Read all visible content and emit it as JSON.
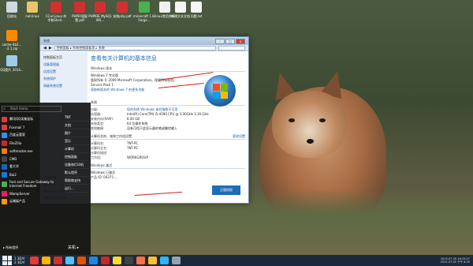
{
  "desktop_icons": [
    {
      "label": "回收站"
    },
    {
      "label": "nat-linux"
    },
    {
      "label": "CCal Linux 命令和Shell..."
    },
    {
      "label": "PHP环境配置.pdf"
    },
    {
      "label": "PHPIDE MySQL WS..."
    },
    {
      "label": "安装php.pdf"
    },
    {
      "label": "minecraft 1.8-Forge..."
    },
    {
      "label": "linux常用命令"
    },
    {
      "label": "新建文本文档"
    },
    {
      "label": "问题.txt"
    },
    {
      "label": "cache-4b2... -2.1.zip"
    },
    {
      "label": "QQ图片 2014..."
    }
  ],
  "window": {
    "title": "系统",
    "address": "控制面板 ▸ 所有控制面板项 ▸ 系统",
    "sidebar_head": "控制面板主页",
    "sidebar_links": [
      "设备管理器",
      "远程设置",
      "系统保护",
      "高级系统设置"
    ],
    "page_title": "查看有关计算机的基本信息",
    "edition_section": "Windows 版本",
    "edition": "Windows 7 专业版",
    "copyright": "版权所有 © 2009 Microsoft Corporation。保留所有权利。",
    "service_pack": "Service Pack 1",
    "upgrade_link": "获取新版本的 Windows 7 的更多功能",
    "system_section": "系统",
    "rating_label": "分级:",
    "rating_value": "您的系统 Windows 体验指数不可用",
    "processor_label": "处理器:",
    "processor_value": "Intel(R) Core(TM) i5-4590 CPU @ 3.30GHz   3.30 GHz",
    "ram_label": "安装内存(RAM):",
    "ram_value": "8.00 GB",
    "systype_label": "系统类型:",
    "systype_value": "64 位操作系统",
    "pen_label": "笔和触摸:",
    "pen_value": "没有可用于此显示器的笔或触控输入",
    "computer_section": "计算机名称、域和工作组设置",
    "change_settings": "更改设置",
    "compname_label": "计算机名:",
    "compname_value": "TNT-PC",
    "fullname_label": "计算机全名:",
    "fullname_value": "TNT-PC",
    "desc_label": "计算机描述:",
    "desc_value": "",
    "workgroup_label": "工作组:",
    "workgroup_value": "WORKGROUP",
    "activation_section": "Windows 激活",
    "activation_value": "Windows 已激活",
    "product_id": "产品 ID: 00371-...",
    "genuine_badge": "正版授权",
    "see_also": "另请参阅",
    "see_also_links": [
      "操作中心",
      "Windows Update",
      "性能信息和工具"
    ]
  },
  "start_menu": {
    "search_placeholder": "Start menu",
    "apps": [
      {
        "label": "腾讯QQ采集鼠标",
        "color": "#e53935"
      },
      {
        "label": "Foxmail 7",
        "color": "#e53935"
      },
      {
        "label": "百度云管家",
        "color": "#2196f3"
      },
      {
        "label": "FileZilla",
        "color": "#c62828"
      },
      {
        "label": "softmaster.exe",
        "color": "#f57c00"
      },
      {
        "label": "CMD",
        "color": "#444444"
      },
      {
        "label": "看大学",
        "color": "#1565c0"
      },
      {
        "label": "Bai2",
        "color": "#1976d2"
      },
      {
        "label": "Fast and Secure Gateway to Internet Freedom",
        "color": "#4caf50"
      },
      {
        "label": "WampServer",
        "color": "#e91e63"
      },
      {
        "label": "云端娱产品",
        "color": "#ff9800"
      }
    ],
    "right_items": [
      "TNT",
      "文档",
      "图片",
      "音乐",
      "计算机",
      "控制面板",
      "设备和打印机",
      "默认程序",
      "帮助和支持",
      "运行..."
    ],
    "all_programs": "所有程序",
    "shutdown": "关机"
  },
  "taskbar": {
    "quick_labels": [
      "1",
      "3D/V",
      "2",
      "3D/V"
    ],
    "time": "2015-07-05 16:33:27",
    "date_line": "2015-07-05 下午 8:30"
  },
  "colors": {
    "accent": "#1e6db5",
    "taskbar": "#1b2a3a",
    "window_border": "#6f8aa8"
  }
}
